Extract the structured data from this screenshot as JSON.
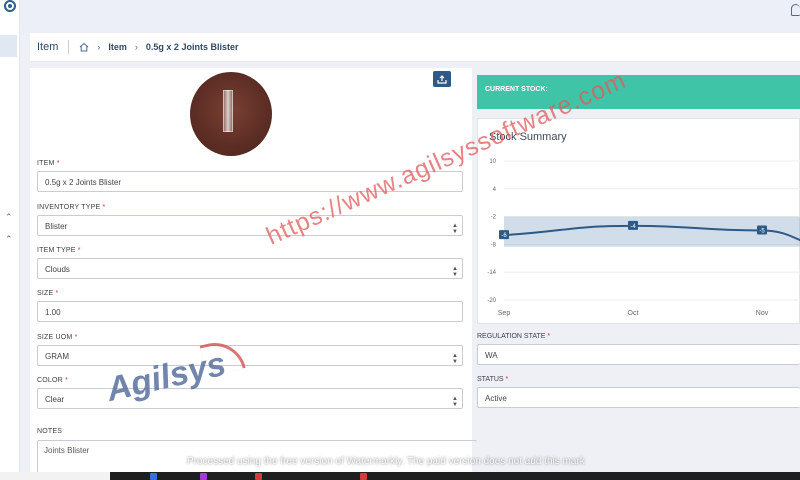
{
  "breadcrumb": {
    "title": "Item",
    "home_icon": "home-icon",
    "separator": "›",
    "links": [
      "Item",
      "0.5g x 2 Joints Blister"
    ]
  },
  "form": {
    "item": {
      "label": "ITEM",
      "value": "0.5g x 2 Joints Blister"
    },
    "inventory_type": {
      "label": "INVENTORY TYPE",
      "value": "Blister"
    },
    "item_type": {
      "label": "ITEM TYPE",
      "value": "Clouds"
    },
    "size": {
      "label": "SIZE",
      "value": "1.00"
    },
    "size_uom": {
      "label": "SIZE UOM",
      "value": "GRAM"
    },
    "color": {
      "label": "COLOR",
      "value": "Clear"
    },
    "notes": {
      "label": "NOTES",
      "value": "Joints Blister"
    },
    "required_mark": "*"
  },
  "stock": {
    "current_label": "CURRENT STOCK:",
    "accent_color": "#40c4a8"
  },
  "chart_data": {
    "type": "area",
    "title": "Stock Summary",
    "xlabel": "",
    "ylabel": "",
    "categories": [
      "Sep",
      "Oct",
      "Nov"
    ],
    "y_ticks": [
      "10",
      "4",
      "-2",
      "-8",
      "-14",
      "-20"
    ],
    "ylim": [
      -20,
      10
    ],
    "series": [
      {
        "values": [
          -6,
          -4,
          -5
        ]
      }
    ],
    "data_labels": [
      "-6",
      "-4",
      "-5"
    ],
    "grid": true,
    "line_color": "#2d5a86"
  },
  "right_fields": {
    "regulation_state": {
      "label": "REGULATION STATE",
      "value": "WA"
    },
    "status": {
      "label": "STATUS",
      "value": "Active"
    }
  },
  "watermarks": {
    "url_text": "https://www.agilsyssoftware.com",
    "logo_text": "Agilsys",
    "processed_note": "Processed using the free version of Watermarkly. The paid version does not add this mark"
  },
  "icons": {
    "upload": "upload-icon",
    "bell": "bell-icon",
    "caret": "chevron-down-icon"
  }
}
